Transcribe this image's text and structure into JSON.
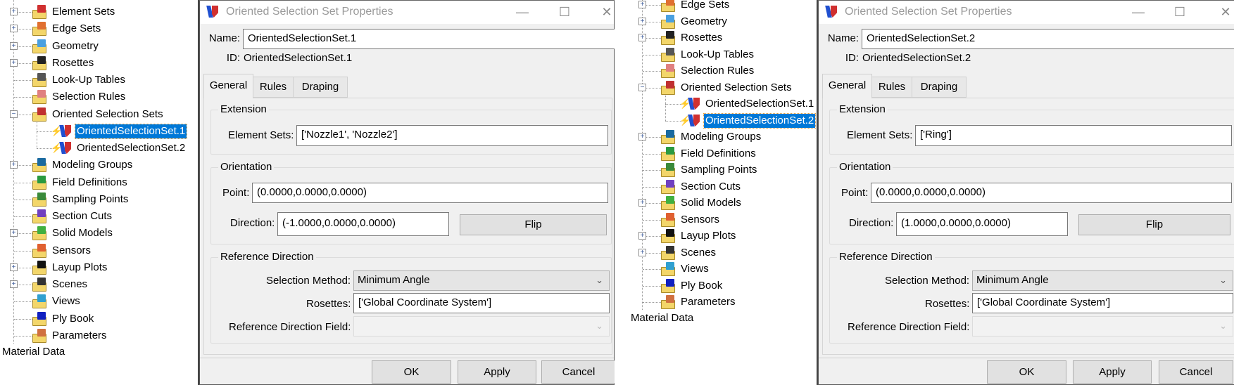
{
  "panels": [
    {
      "tree": {
        "items": [
          {
            "label": "Element Sets",
            "level": 0,
            "expander": "+",
            "accent": "#d03030"
          },
          {
            "label": "Edge Sets",
            "level": 0,
            "expander": "+",
            "accent": "#e07030"
          },
          {
            "label": "Geometry",
            "level": 0,
            "expander": "+",
            "accent": "#4aa0e0"
          },
          {
            "label": "Rosettes",
            "level": 0,
            "expander": "+",
            "accent": "#222222"
          },
          {
            "label": "Look-Up Tables",
            "level": 0,
            "expander": "",
            "accent": "#555555"
          },
          {
            "label": "Selection Rules",
            "level": 0,
            "expander": "",
            "accent": "#e08080"
          },
          {
            "label": "Oriented Selection Sets",
            "level": 0,
            "expander": "-",
            "accent": "#c03030"
          },
          {
            "label": "OrientedSelectionSet.1",
            "level": 1,
            "selected": true
          },
          {
            "label": "OrientedSelectionSet.2",
            "level": 1
          },
          {
            "label": "Modeling Groups",
            "level": 0,
            "expander": "+",
            "accent": "#1a6aa0"
          },
          {
            "label": "Field Definitions",
            "level": 0,
            "expander": "",
            "accent": "#2a9a40"
          },
          {
            "label": "Sampling Points",
            "level": 0,
            "expander": "",
            "accent": "#3a8a3a"
          },
          {
            "label": "Section Cuts",
            "level": 0,
            "expander": "",
            "accent": "#7040c0"
          },
          {
            "label": "Solid Models",
            "level": 0,
            "expander": "+",
            "accent": "#40b040"
          },
          {
            "label": "Sensors",
            "level": 0,
            "expander": "",
            "accent": "#e06030"
          },
          {
            "label": "Layup Plots",
            "level": 0,
            "expander": "+",
            "accent": "#111111"
          },
          {
            "label": "Scenes",
            "level": 0,
            "expander": "+",
            "accent": "#333333"
          },
          {
            "label": "Views",
            "level": 0,
            "expander": "",
            "accent": "#30a0d0"
          },
          {
            "label": "Ply Book",
            "level": 0,
            "expander": "",
            "accent": "#1020c0"
          },
          {
            "label": "Parameters",
            "level": 0,
            "expander": "",
            "accent": "#d07040"
          }
        ],
        "root_label": "Material Data"
      },
      "dialog": {
        "title": "Oriented Selection Set Properties",
        "name_label": "Name:",
        "name_value": "OrientedSelectionSet.1",
        "id_label": "ID:",
        "id_value": "OrientedSelectionSet.1",
        "tabs": [
          "General",
          "Rules",
          "Draping"
        ],
        "extension_label": "Extension",
        "element_sets_label": "Element Sets:",
        "element_sets_value": "['Nozzle1', 'Nozzle2']",
        "orientation_label": "Orientation",
        "point_label": "Point:",
        "point_value": "(0.0000,0.0000,0.0000)",
        "direction_label": "Direction:",
        "direction_value": "(-1.0000,0.0000,0.0000)",
        "flip_label": "Flip",
        "refdir_label": "Reference Direction",
        "selection_method_label": "Selection Method:",
        "selection_method_value": "Minimum Angle",
        "rosettes_label": "Rosettes:",
        "rosettes_value": "['Global Coordinate System']",
        "refdir_field_label": "Reference Direction Field:",
        "refdir_field_value": "",
        "ok_label": "OK",
        "apply_label": "Apply",
        "cancel_label": "Cancel"
      }
    },
    {
      "tree": {
        "items": [
          {
            "label": "Edge Sets",
            "level": 0,
            "expander": "+",
            "accent": "#e07030"
          },
          {
            "label": "Geometry",
            "level": 0,
            "expander": "+",
            "accent": "#4aa0e0"
          },
          {
            "label": "Rosettes",
            "level": 0,
            "expander": "+",
            "accent": "#222222"
          },
          {
            "label": "Look-Up Tables",
            "level": 0,
            "expander": "",
            "accent": "#555555"
          },
          {
            "label": "Selection Rules",
            "level": 0,
            "expander": "",
            "accent": "#e08080"
          },
          {
            "label": "Oriented Selection Sets",
            "level": 0,
            "expander": "-",
            "accent": "#c03030"
          },
          {
            "label": "OrientedSelectionSet.1",
            "level": 1
          },
          {
            "label": "OrientedSelectionSet.2",
            "level": 1,
            "selected": true
          },
          {
            "label": "Modeling Groups",
            "level": 0,
            "expander": "+",
            "accent": "#1a6aa0"
          },
          {
            "label": "Field Definitions",
            "level": 0,
            "expander": "",
            "accent": "#2a9a40"
          },
          {
            "label": "Sampling Points",
            "level": 0,
            "expander": "",
            "accent": "#3a8a3a"
          },
          {
            "label": "Section Cuts",
            "level": 0,
            "expander": "",
            "accent": "#7040c0"
          },
          {
            "label": "Solid Models",
            "level": 0,
            "expander": "+",
            "accent": "#40b040"
          },
          {
            "label": "Sensors",
            "level": 0,
            "expander": "",
            "accent": "#e06030"
          },
          {
            "label": "Layup Plots",
            "level": 0,
            "expander": "+",
            "accent": "#111111"
          },
          {
            "label": "Scenes",
            "level": 0,
            "expander": "+",
            "accent": "#333333"
          },
          {
            "label": "Views",
            "level": 0,
            "expander": "",
            "accent": "#30a0d0"
          },
          {
            "label": "Ply Book",
            "level": 0,
            "expander": "",
            "accent": "#1020c0"
          },
          {
            "label": "Parameters",
            "level": 0,
            "expander": "",
            "accent": "#d07040"
          }
        ],
        "root_label": "Material Data"
      },
      "dialog": {
        "title": "Oriented Selection Set Properties",
        "name_label": "Name:",
        "name_value": "OrientedSelectionSet.2",
        "id_label": "ID:",
        "id_value": "OrientedSelectionSet.2",
        "tabs": [
          "General",
          "Rules",
          "Draping"
        ],
        "extension_label": "Extension",
        "element_sets_label": "Element Sets:",
        "element_sets_value": "['Ring']",
        "orientation_label": "Orientation",
        "point_label": "Point:",
        "point_value": "(0.0000,0.0000,0.0000)",
        "direction_label": "Direction:",
        "direction_value": "(1.0000,0.0000,0.0000)",
        "flip_label": "Flip",
        "refdir_label": "Reference Direction",
        "selection_method_label": "Selection Method:",
        "selection_method_value": "Minimum Angle",
        "rosettes_label": "Rosettes:",
        "rosettes_value": "['Global Coordinate System']",
        "refdir_field_label": "Reference Direction Field:",
        "refdir_field_value": "",
        "ok_label": "OK",
        "apply_label": "Apply",
        "cancel_label": "Cancel"
      }
    }
  ]
}
